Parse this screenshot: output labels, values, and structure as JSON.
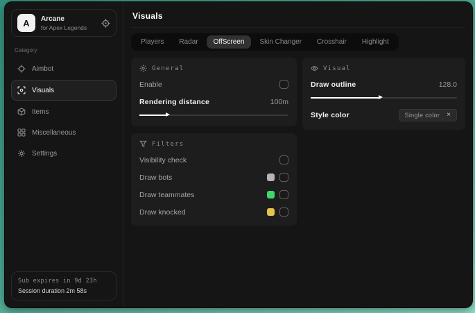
{
  "colors": {
    "desktop_teal_top": "#35907d",
    "desktop_teal_bottom": "#8fe0ca",
    "swatch_bots": "#b5b5b5",
    "swatch_teammates": "#3fd96b",
    "swatch_knocked": "#e2c44d"
  },
  "brand": {
    "initial": "A",
    "name": "Arcane",
    "subtitle": "for Apex Legends"
  },
  "sidebar": {
    "category_label": "Category",
    "items": [
      {
        "label": "Aimbot",
        "selected": false
      },
      {
        "label": "Visuals",
        "selected": true
      },
      {
        "label": "Items",
        "selected": false
      },
      {
        "label": "Miscellaneous",
        "selected": false
      },
      {
        "label": "Settings",
        "selected": false
      }
    ],
    "footer": {
      "sub_expires": "Sub expires in 9d 23h",
      "session_duration": "Session duration 2m 58s"
    }
  },
  "main": {
    "title": "Visuals",
    "selected_tab": "OffScreen",
    "tabs": [
      {
        "label": "Players"
      },
      {
        "label": "Radar"
      },
      {
        "label": "OffScreen"
      },
      {
        "label": "Skin Changer"
      },
      {
        "label": "Crosshair"
      },
      {
        "label": "Highlight"
      }
    ],
    "panels": {
      "general": {
        "title": "General",
        "enable_label": "Enable",
        "enable_checked": false,
        "rendering_label": "Rendering distance",
        "rendering_value": "100m",
        "rendering_fill": "19%"
      },
      "filters": {
        "title": "Filters",
        "rows": [
          {
            "label": "Visibility check",
            "checked": false
          },
          {
            "label": "Draw bots",
            "swatch": "#b5b5b5",
            "checked": false
          },
          {
            "label": "Draw teammates",
            "swatch": "#3fd96b",
            "checked": false
          },
          {
            "label": "Draw knocked",
            "swatch": "#e2c44d",
            "checked": false
          }
        ]
      },
      "visual": {
        "title": "Visual",
        "outline_label": "Draw outline",
        "outline_value": "128.0",
        "outline_fill": "48%",
        "style_label": "Style color",
        "chip_label": "Single color",
        "chip_close": "×"
      }
    }
  }
}
